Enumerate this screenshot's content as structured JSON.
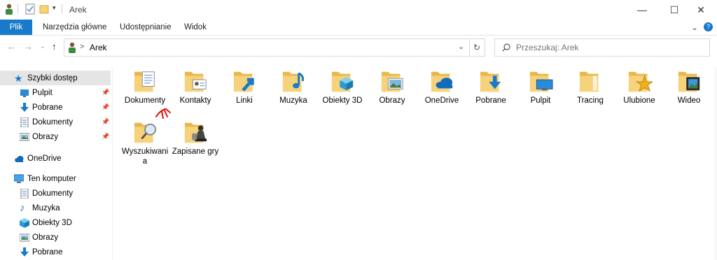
{
  "window": {
    "title": "Arek",
    "minimize": "—",
    "maximize": "☐",
    "close": "✕"
  },
  "ribbon": {
    "tabs": [
      "Plik",
      "Narzędzia główne",
      "Udostępnianie",
      "Widok"
    ],
    "expand": "⌄",
    "help": "?"
  },
  "address": {
    "separator": ">",
    "path": "Arek",
    "dropdown": "⌄",
    "refresh": "↻"
  },
  "search": {
    "placeholder": "Przeszukaj: Arek"
  },
  "sidebar": {
    "quick_access": "Szybki dostęp",
    "quick_items": [
      "Pulpit",
      "Pobrane",
      "Dokumenty",
      "Obrazy"
    ],
    "onedrive": "OneDrive",
    "this_pc": "Ten komputer",
    "pc_items": [
      "Dokumenty",
      "Muzyka",
      "Obiekty 3D",
      "Obrazy",
      "Pobrane"
    ]
  },
  "folders": [
    {
      "label": "Dokumenty",
      "icon": "documents-icon"
    },
    {
      "label": "Kontakty",
      "icon": "contacts-icon"
    },
    {
      "label": "Linki",
      "icon": "links-icon"
    },
    {
      "label": "Muzyka",
      "icon": "music-icon"
    },
    {
      "label": "Obiekty 3D",
      "icon": "objects3d-icon"
    },
    {
      "label": "Obrazy",
      "icon": "pictures-icon"
    },
    {
      "label": "OneDrive",
      "icon": "onedrive-icon"
    },
    {
      "label": "Pobrane",
      "icon": "downloads-icon"
    },
    {
      "label": "Pulpit",
      "icon": "desktop-icon"
    },
    {
      "label": "Tracing",
      "icon": "folder-icon"
    },
    {
      "label": "Ulubione",
      "icon": "favorites-icon"
    },
    {
      "label": "Wideo",
      "icon": "videos-icon"
    },
    {
      "label": "Wyszukiwania",
      "icon": "searches-icon"
    },
    {
      "label": "Zapisane gry",
      "icon": "saved-games-icon"
    }
  ],
  "colors": {
    "accent": "#1979ca",
    "folder_back": "#e8b84f",
    "folder_front": "#f6d27a",
    "selection": "#cce8ff",
    "annotation": "#e01010"
  }
}
